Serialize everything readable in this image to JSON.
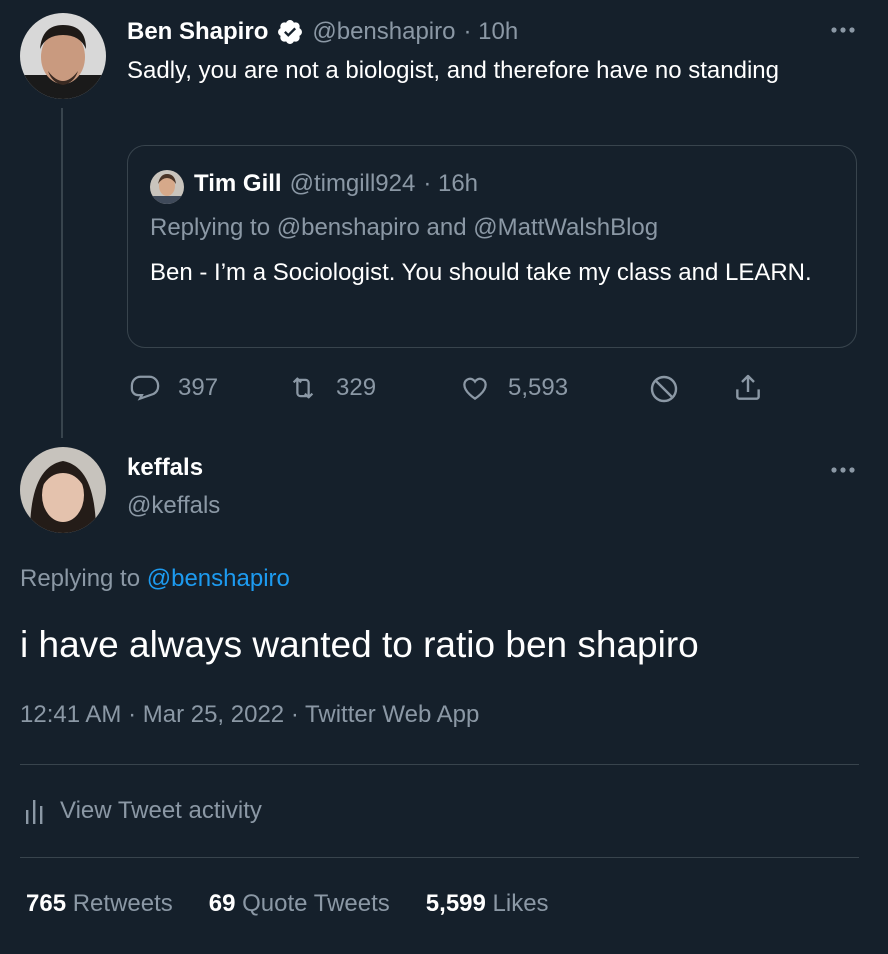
{
  "parent_tweet": {
    "author_name": "Ben Shapiro",
    "handle": "@benshapiro",
    "time": "· 10h",
    "text": "Sadly, you are not a biologist, and therefore have no standing",
    "quoted": {
      "author_name": "Tim Gill",
      "handle": "@timgill924",
      "time": "· 16h",
      "replying_prefix": "Replying to",
      "replying_users": "@benshapiro and @MattWalshBlog",
      "text": "Ben - I’m a Sociologist. You should take my class and LEARN."
    },
    "actions": {
      "replies": "397",
      "retweets": "329",
      "likes": "5,593"
    }
  },
  "main_tweet": {
    "author_name": "keffals",
    "handle": "@keffals",
    "replying_prefix": "Replying to",
    "replying_user": "@benshapiro",
    "text": "i have always wanted to ratio ben shapiro",
    "meta": "12:41 AM · Mar 25, 2022 · Twitter Web App",
    "activity_label": "View Tweet activity",
    "stats": {
      "retweets_count": "765",
      "retweets_label": "Retweets",
      "quotes_count": "69",
      "quotes_label": "Quote Tweets",
      "likes_count": "5,599",
      "likes_label": "Likes"
    }
  },
  "colors": {
    "background": "#15202b",
    "text": "#ffffff",
    "muted": "#8b98a5",
    "accent": "#1d9bf0",
    "divider": "#38444d"
  },
  "icons": [
    "more-icon",
    "verified-icon",
    "reply-icon",
    "retweet-icon",
    "like-icon",
    "block-icon",
    "share-icon",
    "activity-icon"
  ]
}
